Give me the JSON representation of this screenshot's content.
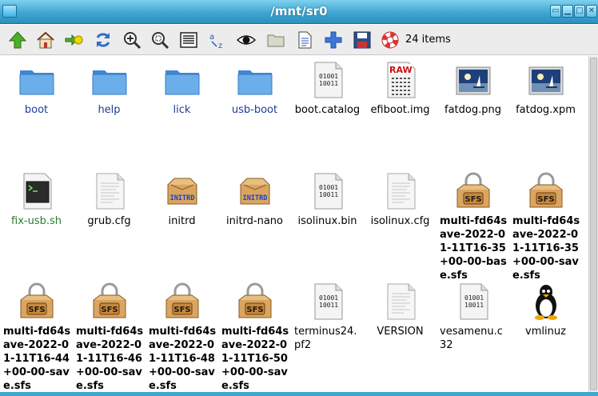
{
  "window": {
    "title": "/mnt/sr0",
    "buttons": [
      {
        "name": "shade-button",
        "glyph": "▭"
      },
      {
        "name": "minimize-button",
        "glyph": "▁"
      },
      {
        "name": "maximize-button",
        "glyph": "□"
      },
      {
        "name": "close-button",
        "glyph": "✕"
      }
    ]
  },
  "toolbar": {
    "buttons": [
      {
        "name": "up-button",
        "icon": "up-arrow-icon"
      },
      {
        "name": "home-button",
        "icon": "home-icon"
      },
      {
        "name": "goto-bookmark-button",
        "icon": "bookmark-go-icon"
      },
      {
        "name": "refresh-button",
        "icon": "refresh-icon"
      },
      {
        "name": "zoom-in-button",
        "icon": "zoom-in-icon"
      },
      {
        "name": "zoom-fit-button",
        "icon": "zoom-fit-icon"
      },
      {
        "name": "details-view-button",
        "icon": "details-view-icon"
      },
      {
        "name": "sort-button",
        "icon": "sort-az-icon"
      },
      {
        "name": "show-hidden-button",
        "icon": "eye-icon"
      },
      {
        "name": "select-folder-button",
        "icon": "folder-icon"
      },
      {
        "name": "file-info-button",
        "icon": "document-icon"
      },
      {
        "name": "new-button",
        "icon": "plus-icon"
      },
      {
        "name": "save-button",
        "icon": "floppy-icon"
      },
      {
        "name": "help-button",
        "icon": "lifebuoy-icon"
      }
    ],
    "items_count": "24 items"
  },
  "files": [
    {
      "label": "boot",
      "type": "folder",
      "style": "dir"
    },
    {
      "label": "help",
      "type": "folder",
      "style": "dir"
    },
    {
      "label": "lick",
      "type": "folder",
      "style": "dir"
    },
    {
      "label": "usb-boot",
      "type": "folder",
      "style": "dir"
    },
    {
      "label": "boot.catalog",
      "type": "binary",
      "style": "file"
    },
    {
      "label": "efiboot.img",
      "type": "raw",
      "style": "file"
    },
    {
      "label": "fatdog.png",
      "type": "image",
      "style": "file"
    },
    {
      "label": "fatdog.xpm",
      "type": "image",
      "style": "file"
    },
    {
      "label": "fix-usb.sh",
      "type": "script",
      "style": "exec"
    },
    {
      "label": "grub.cfg",
      "type": "text",
      "style": "file"
    },
    {
      "label": "initrd",
      "type": "initrd",
      "style": "file"
    },
    {
      "label": "initrd-nano",
      "type": "initrd",
      "style": "file"
    },
    {
      "label": "isolinux.bin",
      "type": "binary",
      "style": "file"
    },
    {
      "label": "isolinux.cfg",
      "type": "text",
      "style": "file"
    },
    {
      "label": "multi-fd64save-2022-01-11T16-35+00-00-base.sfs",
      "type": "sfs",
      "style": "bold"
    },
    {
      "label": "multi-fd64save-2022-01-11T16-35+00-00-save.sfs",
      "type": "sfs",
      "style": "bold"
    },
    {
      "label": "multi-fd64save-2022-01-11T16-44+00-00-save.sfs",
      "type": "sfs",
      "style": "bold"
    },
    {
      "label": "multi-fd64save-2022-01-11T16-46+00-00-save.sfs",
      "type": "sfs",
      "style": "bold"
    },
    {
      "label": "multi-fd64save-2022-01-11T16-48+00-00-save.sfs",
      "type": "sfs",
      "style": "bold"
    },
    {
      "label": "multi-fd64save-2022-01-11T16-50+00-00-save.sfs",
      "type": "sfs",
      "style": "bold"
    },
    {
      "label": "terminus24.pf2",
      "type": "binary",
      "style": "left"
    },
    {
      "label": "VERSION",
      "type": "text",
      "style": "file"
    },
    {
      "label": "vesamenu.c32",
      "type": "binary",
      "style": "left"
    },
    {
      "label": "vmlinuz",
      "type": "tux",
      "style": "file"
    }
  ],
  "icon_text": {
    "binary_top": "01001",
    "binary_bottom": "10011",
    "raw": "RAW",
    "initrd": "INITRD",
    "sfs": "SFS"
  },
  "colors": {
    "titlebar": "#3fa6d2",
    "folder": "#5b9de0",
    "directory_label": "#1f3b9a",
    "executable_label": "#2a7d2a"
  }
}
